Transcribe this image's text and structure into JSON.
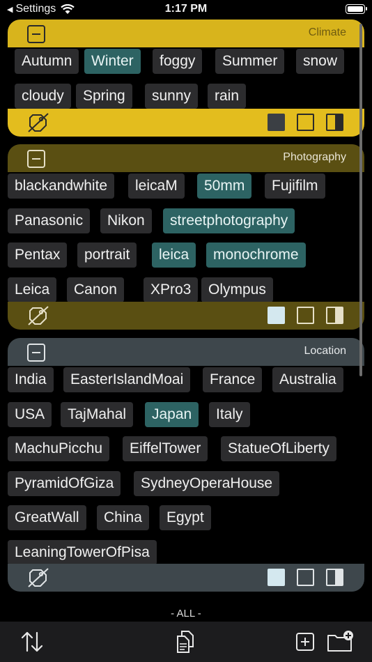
{
  "status": {
    "back_label": "Settings",
    "time": "1:17 PM"
  },
  "colors": {
    "climate_header": "#d8b41c",
    "climate_footer": "#e3bd1e",
    "photo_header": "#5a4f12",
    "photo_footer": "#5a4f12",
    "location_header": "#3e474c",
    "location_footer": "#3e474c",
    "tag_bg": "#2c2c2e",
    "tag_selected_bg": "#2d6363"
  },
  "sections": [
    {
      "title": "Climate",
      "tags": [
        {
          "label": "Autumn",
          "selected": false
        },
        {
          "label": "Winter",
          "selected": true
        },
        {
          "label": "foggy",
          "selected": false
        },
        {
          "label": "Summer",
          "selected": false
        },
        {
          "label": "snow",
          "selected": false
        },
        {
          "label": "cloudy",
          "selected": false
        },
        {
          "label": "Spring",
          "selected": false
        },
        {
          "label": "sunny",
          "selected": false
        },
        {
          "label": "rain",
          "selected": false
        }
      ]
    },
    {
      "title": "Photography",
      "tags": [
        {
          "label": "blackandwhite",
          "selected": false
        },
        {
          "label": "leicaM",
          "selected": false
        },
        {
          "label": "50mm",
          "selected": true
        },
        {
          "label": "Fujifilm",
          "selected": false
        },
        {
          "label": "Panasonic",
          "selected": false
        },
        {
          "label": "Nikon",
          "selected": false
        },
        {
          "label": "streetphotography",
          "selected": true
        },
        {
          "label": "Pentax",
          "selected": false
        },
        {
          "label": "portrait",
          "selected": false
        },
        {
          "label": "leica",
          "selected": true
        },
        {
          "label": "monochrome",
          "selected": true
        },
        {
          "label": "Leica",
          "selected": false
        },
        {
          "label": "Canon",
          "selected": false
        },
        {
          "label": "XPro3",
          "selected": false
        },
        {
          "label": "Olympus",
          "selected": false
        }
      ]
    },
    {
      "title": "Location",
      "tags": [
        {
          "label": "India",
          "selected": false
        },
        {
          "label": "EasterIslandMoai",
          "selected": false
        },
        {
          "label": "France",
          "selected": false
        },
        {
          "label": "Australia",
          "selected": false
        },
        {
          "label": "USA",
          "selected": false
        },
        {
          "label": "TajMahal",
          "selected": false
        },
        {
          "label": "Japan",
          "selected": true
        },
        {
          "label": "Italy",
          "selected": false
        },
        {
          "label": "MachuPicchu",
          "selected": false
        },
        {
          "label": "EiffelTower",
          "selected": false
        },
        {
          "label": "StatueOfLiberty",
          "selected": false
        },
        {
          "label": "PyramidOfGiza",
          "selected": false
        },
        {
          "label": "SydneyOperaHouse",
          "selected": false
        },
        {
          "label": "GreatWall",
          "selected": false
        },
        {
          "label": "China",
          "selected": false
        },
        {
          "label": "Egypt",
          "selected": false
        },
        {
          "label": "LeaningTowerOfPisa",
          "selected": false
        }
      ]
    }
  ],
  "filter_label": "- ALL -",
  "icons": {
    "toolbar": [
      "sort-arrows-icon",
      "copy-documents-icon",
      "add-square-icon",
      "new-folder-icon"
    ],
    "footer": [
      "tag-off-icon",
      "filled-square-icon",
      "empty-square-icon",
      "half-square-icon"
    ]
  }
}
